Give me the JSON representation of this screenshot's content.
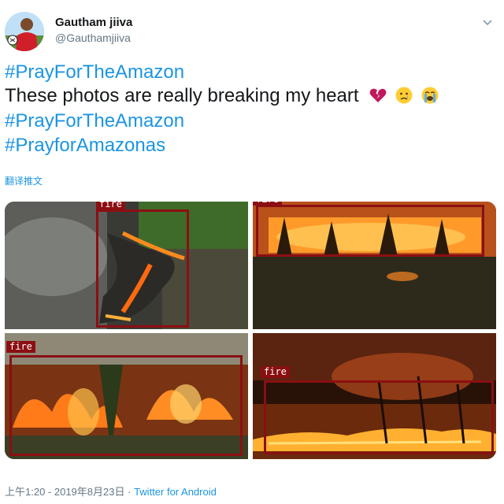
{
  "tweet": {
    "author_name": "Gautham jiiva",
    "author_handle": "@Gauthamjiiva",
    "lines": [
      {
        "text": "#PrayForTheAmazon",
        "kind": "hashtag"
      },
      {
        "text": "These photos are really breaking my heart",
        "kind": "plain"
      },
      {
        "text": "#PrayForTheAmazon",
        "kind": "hashtag"
      },
      {
        "text": "#PrayforAmazonas",
        "kind": "hashtag"
      }
    ],
    "emojis": [
      "broken-heart-icon",
      "crying-face-icon",
      "loudly-crying-face-icon"
    ],
    "translate_label": "翻译推文",
    "timestamp": "上午1:20 - 2019年8月23日",
    "separator": "·",
    "client": "Twitter for Android"
  },
  "detections": [
    {
      "label": "fire"
    },
    {
      "label": "fire"
    },
    {
      "label": "fire"
    },
    {
      "label": "fire"
    }
  ],
  "colors": {
    "hashtag": "#1b95e0",
    "detection_box": "#8b0f12",
    "meta_text": "#657786"
  }
}
